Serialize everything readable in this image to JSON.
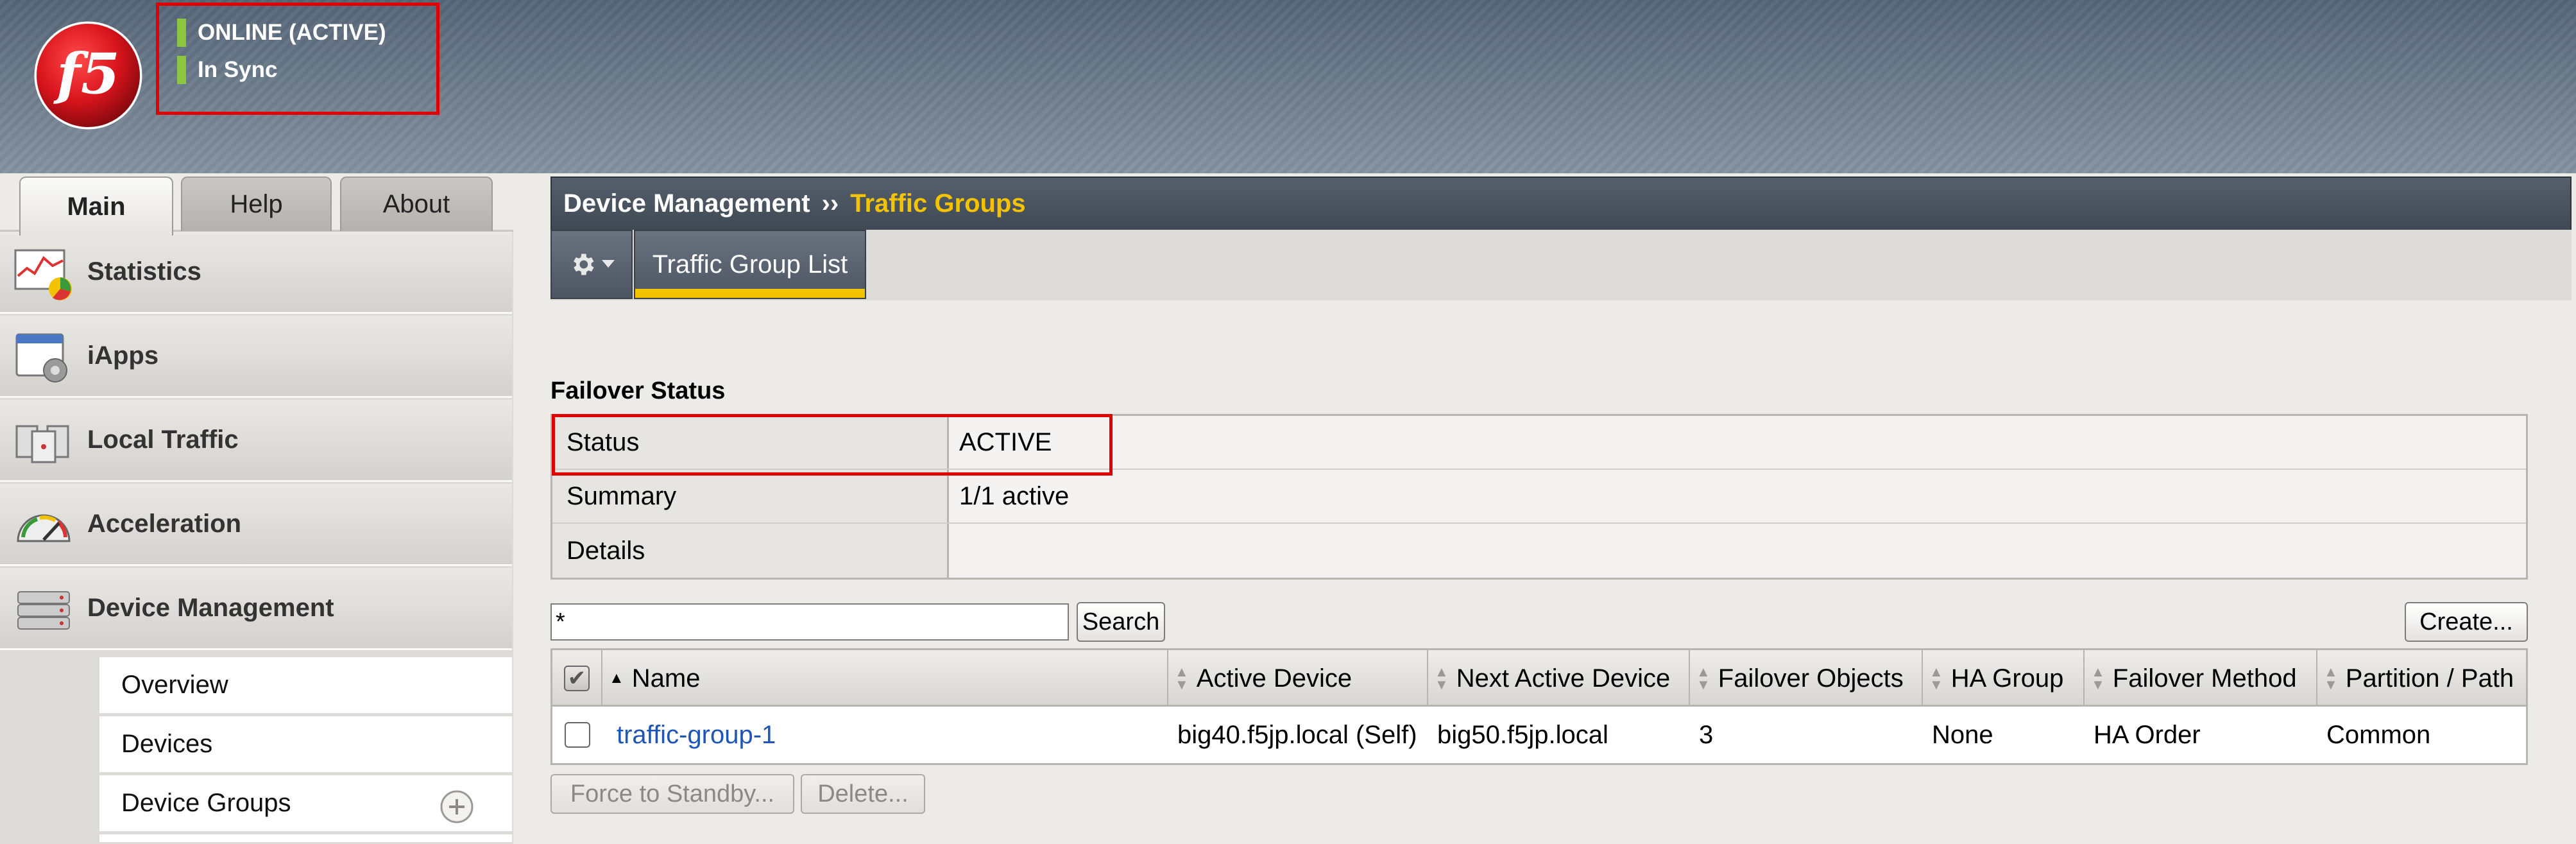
{
  "status": {
    "online": "ONLINE (ACTIVE)",
    "sync": "In Sync"
  },
  "brand": {
    "logo_text": "f5"
  },
  "top_tabs": [
    {
      "label": "Main",
      "active": true
    },
    {
      "label": "Help",
      "active": false
    },
    {
      "label": "About",
      "active": false
    }
  ],
  "nav": {
    "items": [
      {
        "label": "Statistics",
        "icon": "statistics-icon"
      },
      {
        "label": "iApps",
        "icon": "iapps-icon"
      },
      {
        "label": "Local Traffic",
        "icon": "local-traffic-icon"
      },
      {
        "label": "Acceleration",
        "icon": "acceleration-icon"
      },
      {
        "label": "Device Management",
        "icon": "device-management-icon"
      }
    ],
    "sub_items": [
      "Overview",
      "Devices",
      "Device Groups"
    ]
  },
  "breadcrumb": {
    "section": "Device Management",
    "separator": "››",
    "current": "Traffic Groups"
  },
  "subtab": {
    "label": "Traffic Group List"
  },
  "failover": {
    "title": "Failover Status",
    "rows": [
      {
        "label": "Status",
        "value": "ACTIVE"
      },
      {
        "label": "Summary",
        "value": "1/1 active"
      },
      {
        "label": "Details",
        "value": ""
      }
    ]
  },
  "search": {
    "value": "*",
    "button": "Search"
  },
  "create_button": "Create...",
  "grid": {
    "columns": [
      "Name",
      "Active Device",
      "Next Active Device",
      "Failover Objects",
      "HA Group",
      "Failover Method",
      "Partition / Path"
    ],
    "rows": [
      [
        "traffic-group-1",
        "big40.f5jp.local (Self)",
        "big50.f5jp.local",
        "3",
        "None",
        "HA Order",
        "Common"
      ]
    ]
  },
  "actions": {
    "force_standby": "Force to Standby...",
    "delete": "Delete..."
  },
  "colors": {
    "accent": "#f4c300",
    "status_ok": "#8cc63f",
    "highlight": "#e00000",
    "link": "#1f56b5",
    "logo_red": "#d8141c"
  }
}
